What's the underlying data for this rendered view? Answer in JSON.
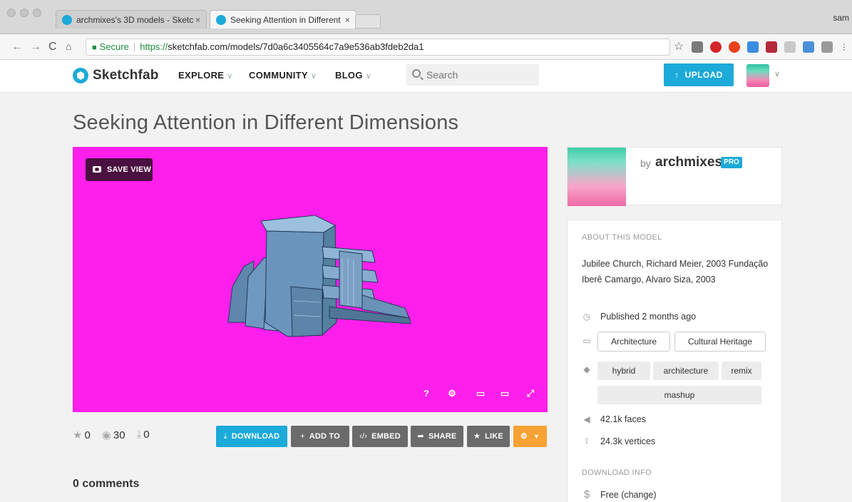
{
  "browser": {
    "tabs": [
      {
        "label": "archmixes's 3D models - Sketc",
        "close": "×"
      },
      {
        "label": "Seeking Attention in Different",
        "close": "×"
      }
    ],
    "user": "sam",
    "secure_label": "Secure",
    "url_proto": "https://",
    "url_host": "sketchfab.com",
    "url_path": "/models/7d0a6c3405564c7a9e536ab3fdeb2da1",
    "star_icon": "☆"
  },
  "header": {
    "logo": "Sketchfab",
    "nav": [
      "EXPLORE",
      "COMMUNITY",
      "BLOG"
    ],
    "search_placeholder": "Search",
    "upload_label": "UPLOAD"
  },
  "model": {
    "title": "Seeking Attention in Different Dimensions",
    "save_view": "SAVE VIEW",
    "viewer_bg": "#ff1fec",
    "controls": [
      "?",
      "⚙",
      "▭",
      "▭",
      "⤢"
    ]
  },
  "stats": {
    "likes": "0",
    "views": "30",
    "downloads": "0"
  },
  "actions": {
    "download": "DOWNLOAD",
    "add_to": "ADD TO",
    "embed": "EMBED",
    "share": "SHARE",
    "like": "LIKE"
  },
  "comments": "0 comments",
  "author": {
    "by": "by",
    "name": "archmixes",
    "badge": "PRO"
  },
  "about": {
    "heading": "ABOUT THIS MODEL",
    "description": "Jubilee Church, Richard Meier, 2003 Fundação Iberê Camargo, Alvaro Siza, 2003",
    "published": "Published 2 months ago",
    "categories": [
      "Architecture",
      "Cultural Heritage"
    ],
    "tags": [
      "hybrid",
      "architecture",
      "remix",
      "mashup"
    ],
    "faces": "42.1k faces",
    "vertices": "24.3k vertices",
    "download_heading": "DOWNLOAD INFO",
    "price": "Free",
    "price_change": "(change)"
  },
  "colors": {
    "brand": "#1caad9",
    "button_gray": "#6b6b6b",
    "button_orange": "#f7a233"
  }
}
